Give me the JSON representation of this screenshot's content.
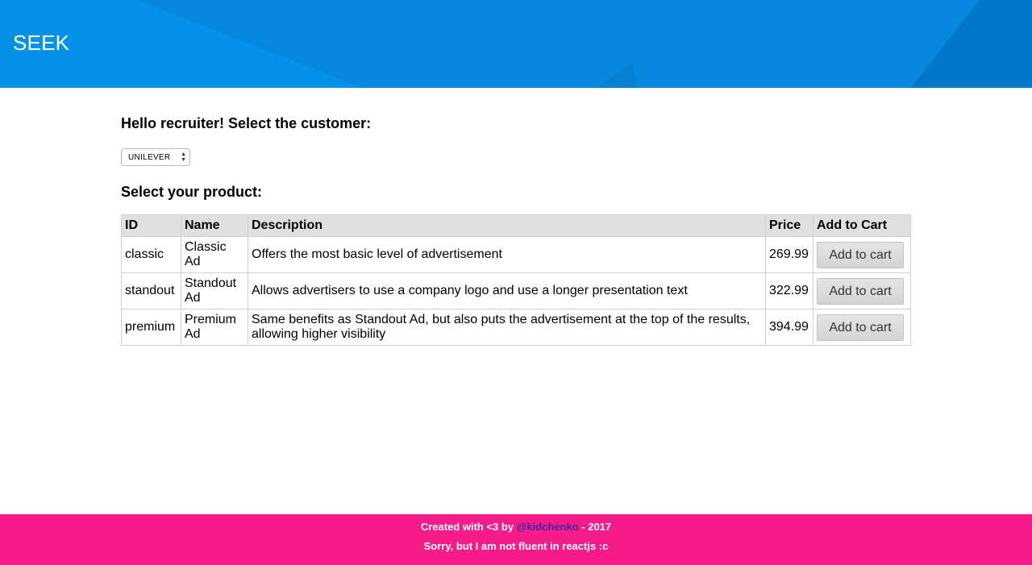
{
  "header": {
    "brand": "SEEK",
    "background_color": "#0a8ee6"
  },
  "main": {
    "greeting": "Hello recruiter! Select the customer:",
    "customer_select": {
      "selected": "UNILEVER"
    },
    "product_heading": "Select your product:",
    "table": {
      "headers": [
        "ID",
        "Name",
        "Description",
        "Price",
        "Add to Cart"
      ],
      "rows": [
        {
          "id": "classic",
          "name": "Classic Ad",
          "description": "Offers the most basic level of advertisement",
          "price": "269.99",
          "button": "Add to cart"
        },
        {
          "id": "standout",
          "name": "Standout Ad",
          "description": "Allows advertisers to use a company logo and use a longer presentation text",
          "price": "322.99",
          "button": "Add to cart"
        },
        {
          "id": "premium",
          "name": "Premium Ad",
          "description": "Same benefits as Standout Ad, but also puts the advertisement at the top of the results, allowing higher visibility",
          "price": "394.99",
          "button": "Add to cart"
        }
      ]
    }
  },
  "footer": {
    "line1_prefix": "Created with <3 by ",
    "author_link": "@kidchenko",
    "line1_suffix": " - 2017",
    "line2": "Sorry, but I am not fluent in reactjs :c",
    "background_color": "#f81c8a",
    "link_color": "#3b2aa6"
  }
}
